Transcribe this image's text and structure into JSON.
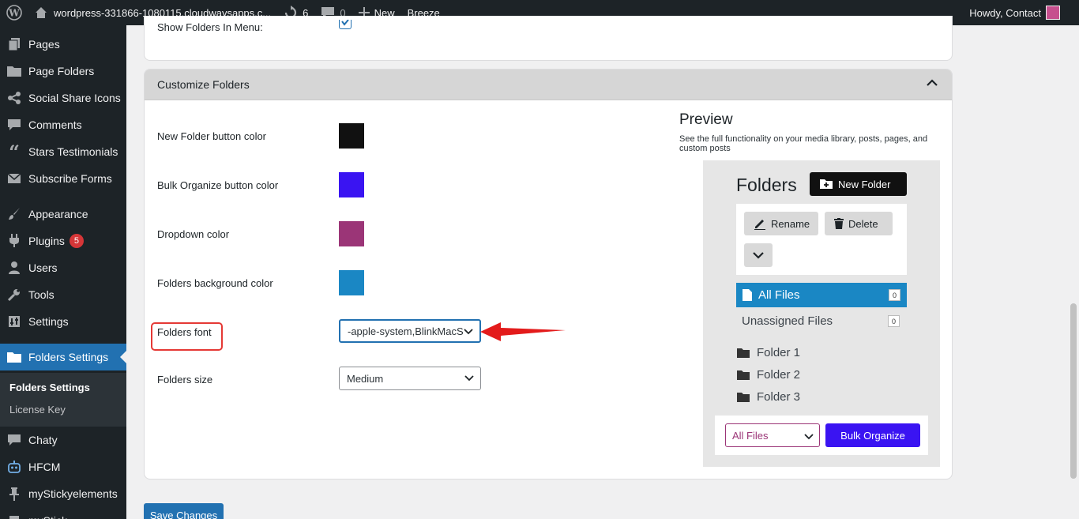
{
  "adminbar": {
    "site": "wordpress-331866-1080115.cloudwaysapps.c...",
    "updates": "6",
    "comments": "0",
    "new_label": "New",
    "breeze": "Breeze",
    "howdy": "Howdy, Contact"
  },
  "sidebar": {
    "items": [
      {
        "label": "Pages",
        "icon": "pages-icon"
      },
      {
        "label": "Page Folders",
        "icon": "folder-icon"
      },
      {
        "label": "Social Share Icons",
        "icon": "share-icon"
      },
      {
        "label": "Comments",
        "icon": "comment-icon"
      },
      {
        "label": "Stars Testimonials",
        "icon": "quote-icon"
      },
      {
        "label": "Subscribe Forms",
        "icon": "mail-icon"
      },
      {
        "label": "Appearance",
        "icon": "brush-icon"
      },
      {
        "label": "Plugins",
        "icon": "plugin-icon",
        "badge": "5"
      },
      {
        "label": "Users",
        "icon": "user-icon"
      },
      {
        "label": "Tools",
        "icon": "wrench-icon"
      },
      {
        "label": "Settings",
        "icon": "settings-icon"
      },
      {
        "label": "Folders Settings",
        "icon": "folder-icon"
      },
      {
        "label": "Chaty",
        "icon": "chat-icon"
      },
      {
        "label": "HFCM",
        "icon": "robot-icon"
      },
      {
        "label": "myStickyelements",
        "icon": "pin-icon"
      }
    ],
    "submenu": [
      "Folders Settings",
      "License Key"
    ],
    "partial_bottom": "myStick"
  },
  "top_panel": {
    "partial_label": "Show Folders In Menu:"
  },
  "customize": {
    "title": "Customize Folders",
    "rows": [
      {
        "label": "New Folder button color",
        "color": "#111111"
      },
      {
        "label": "Bulk Organize button color",
        "color": "#3a14f2"
      },
      {
        "label": "Dropdown color",
        "color": "#9b3577"
      },
      {
        "label": "Folders background color",
        "color": "#1a87c4"
      }
    ],
    "font_label": "Folders font",
    "font_value": "-apple-system,BlinkMacSystemFont",
    "size_label": "Folders size",
    "size_value": "Medium"
  },
  "preview": {
    "title": "Preview",
    "desc": "See the full functionality on your media library, posts, pages, and custom posts",
    "folders_heading": "Folders",
    "new_folder": "New Folder",
    "rename": "Rename",
    "delete": "Delete",
    "all_files": "All Files",
    "all_files_count": "0",
    "unassigned": "Unassigned Files",
    "unassigned_count": "0",
    "folders": [
      "Folder 1",
      "Folder 2",
      "Folder 3"
    ],
    "dropdown_value": "All Files",
    "bulk_organize": "Bulk Organize"
  },
  "save_label": "Save Changes"
}
